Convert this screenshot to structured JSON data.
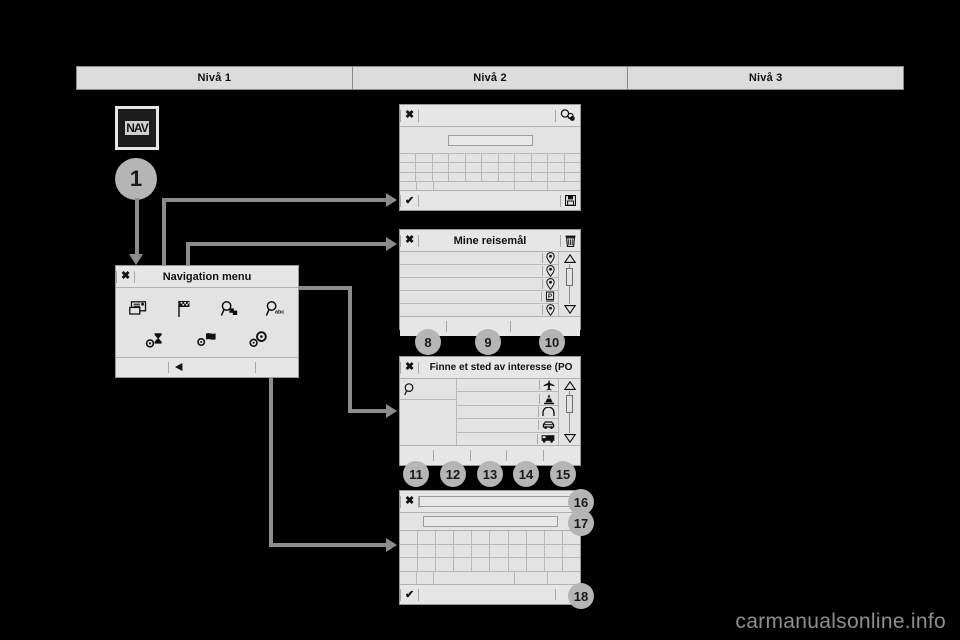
{
  "header": {
    "columns": [
      "Nivå 1",
      "Nivå 2",
      "Nivå 3"
    ]
  },
  "nav_key": {
    "label": "NAV",
    "callout": "1"
  },
  "colors": {
    "background": "#000000",
    "panel_fill": "#e3e3e3",
    "panel_border": "#9a9a9a",
    "header_fill": "#dcdcdc",
    "connector": "#8c8c8c",
    "callout_fill": "#b5b5b5",
    "watermark": "#8f8f8f"
  },
  "panels": {
    "keyboard_entry": {
      "close_icon": "close-icon",
      "title": "",
      "right_icon": "poi-search-icon",
      "input_value": "",
      "confirm_icon": "check-icon",
      "save_icon": "floppy-disk-icon",
      "key_rows": [
        11,
        11,
        11,
        11
      ]
    },
    "my_destinations": {
      "close_icon": "close-icon",
      "title": "Mine reisemål",
      "right_icon": "trash-icon",
      "rows": [
        {
          "icon": "map-pin-icon",
          "label": ""
        },
        {
          "icon": "map-pin-icon",
          "label": ""
        },
        {
          "icon": "map-pin-icon",
          "label": ""
        },
        {
          "icon": "parking-pin-icon",
          "label": ""
        },
        {
          "icon": "map-pin-icon",
          "label": ""
        }
      ],
      "scroll_up_icon": "triangle-up-icon",
      "scroll_down_icon": "triangle-down-icon",
      "callouts": [
        "8",
        "9",
        "10"
      ]
    },
    "poi_search": {
      "close_icon": "close-icon",
      "title": "Finne et sted av interesse (PO",
      "search_icon": "magnifier-icon",
      "rows": [
        {
          "icon": "airplane-icon",
          "label": ""
        },
        {
          "icon": "monument-icon",
          "label": ""
        },
        {
          "icon": "tunnel-icon",
          "label": ""
        },
        {
          "icon": "car-icon",
          "label": ""
        },
        {
          "icon": "bus-icon",
          "label": ""
        }
      ],
      "scroll_up_icon": "triangle-up-icon",
      "scroll_down_icon": "triangle-down-icon",
      "callouts": [
        "11",
        "12",
        "13",
        "14",
        "15"
      ]
    },
    "address_entry": {
      "close_icon": "close-icon",
      "field_1_value": "",
      "field_2_value": "",
      "confirm_icon": "check-icon",
      "key_rows": [
        11,
        11,
        11,
        11
      ],
      "callouts": [
        "16",
        "17",
        "18"
      ]
    },
    "navigation_menu": {
      "close_icon": "close-icon",
      "title": "Navigation menu",
      "icons_row_1": [
        "address-card-icon",
        "checkered-flag-icon",
        "poi-search-icon",
        "search-abc-icon"
      ],
      "icons_row_2": [
        "route-settings-icon",
        "map-settings-icon",
        "system-settings-icon"
      ],
      "back_icon": "back-arrow-icon"
    }
  },
  "watermark": "carmanualsonline.info"
}
